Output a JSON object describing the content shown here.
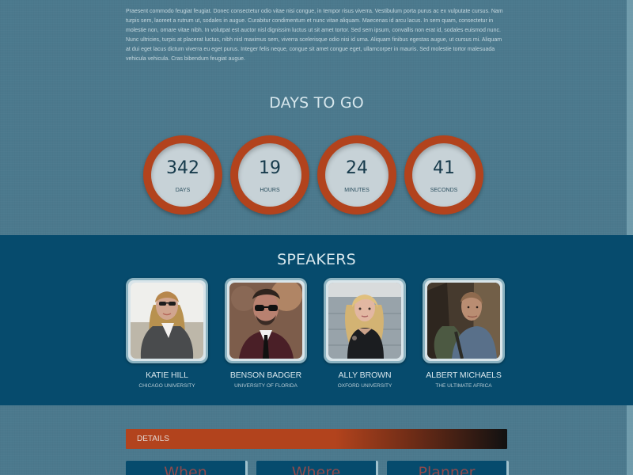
{
  "intro": {
    "paragraph": "Praesent commodo feugiat feugiat. Donec consectetur odio vitae nisi congue, in tempor risus viverra. Vestibulum porta purus ac ex vulputate cursus. Nam turpis sem, laoreet a rutrum ut, sodales in augue. Curabitur condimentum et nunc vitae aliquam. Maecenas id arcu lacus. In sem quam, consectetur in molestie non, ornare vitae nibh. In volutpat est auctor nisl dignissim luctus ut sit amet tortor. Sed sem ipsum, convallis non erat id, sodales euismod nunc. Nunc ultricies, turpis at placerat luctus, nibh nisl maximus sem, viverra scelerisque odio nisi id urna. Aliquam finibus egestas augue, ut cursus mi. Aliquam at dui eget lacus dictum viverra eu eget purus. Integer felis neque, congue sit amet congue eget, ullamcorper in mauris. Sed molestie tortor malesuada vehicula vehicula. Cras bibendum feugiat augue."
  },
  "countdown": {
    "title": "DAYS TO GO",
    "items": [
      {
        "value": "342",
        "label": "DAYS"
      },
      {
        "value": "19",
        "label": "HOURS"
      },
      {
        "value": "24",
        "label": "MINUTES"
      },
      {
        "value": "41",
        "label": "SECONDS"
      }
    ]
  },
  "speakers": {
    "title": "SPEAKERS",
    "items": [
      {
        "name": "KATIE HILL",
        "affiliation": "CHICAGO UNIVERSITY",
        "photo_icon": "woman-in-coat-portrait"
      },
      {
        "name": "BENSON BADGER",
        "affiliation": "UNIVERSITY OF FLORIDA",
        "photo_icon": "man-with-sunglasses-portrait"
      },
      {
        "name": "ALLY BROWN",
        "affiliation": "OXFORD UNIVERSITY",
        "photo_icon": "blonde-woman-portrait"
      },
      {
        "name": "ALBERT MICHAELS",
        "affiliation": "THE ULTIMATE AFRICA",
        "photo_icon": "man-with-backpack-portrait"
      }
    ]
  },
  "details": {
    "label": "DETAILS",
    "tabs": [
      {
        "label": "When"
      },
      {
        "label": "Where"
      },
      {
        "label": "Planner"
      }
    ]
  },
  "colors": {
    "page_background": "#4b798d",
    "timer_ring": "#b2431d",
    "speakers_background": "#064b6d",
    "details_bar_start": "#b2431d",
    "details_bar_end": "#111111"
  }
}
